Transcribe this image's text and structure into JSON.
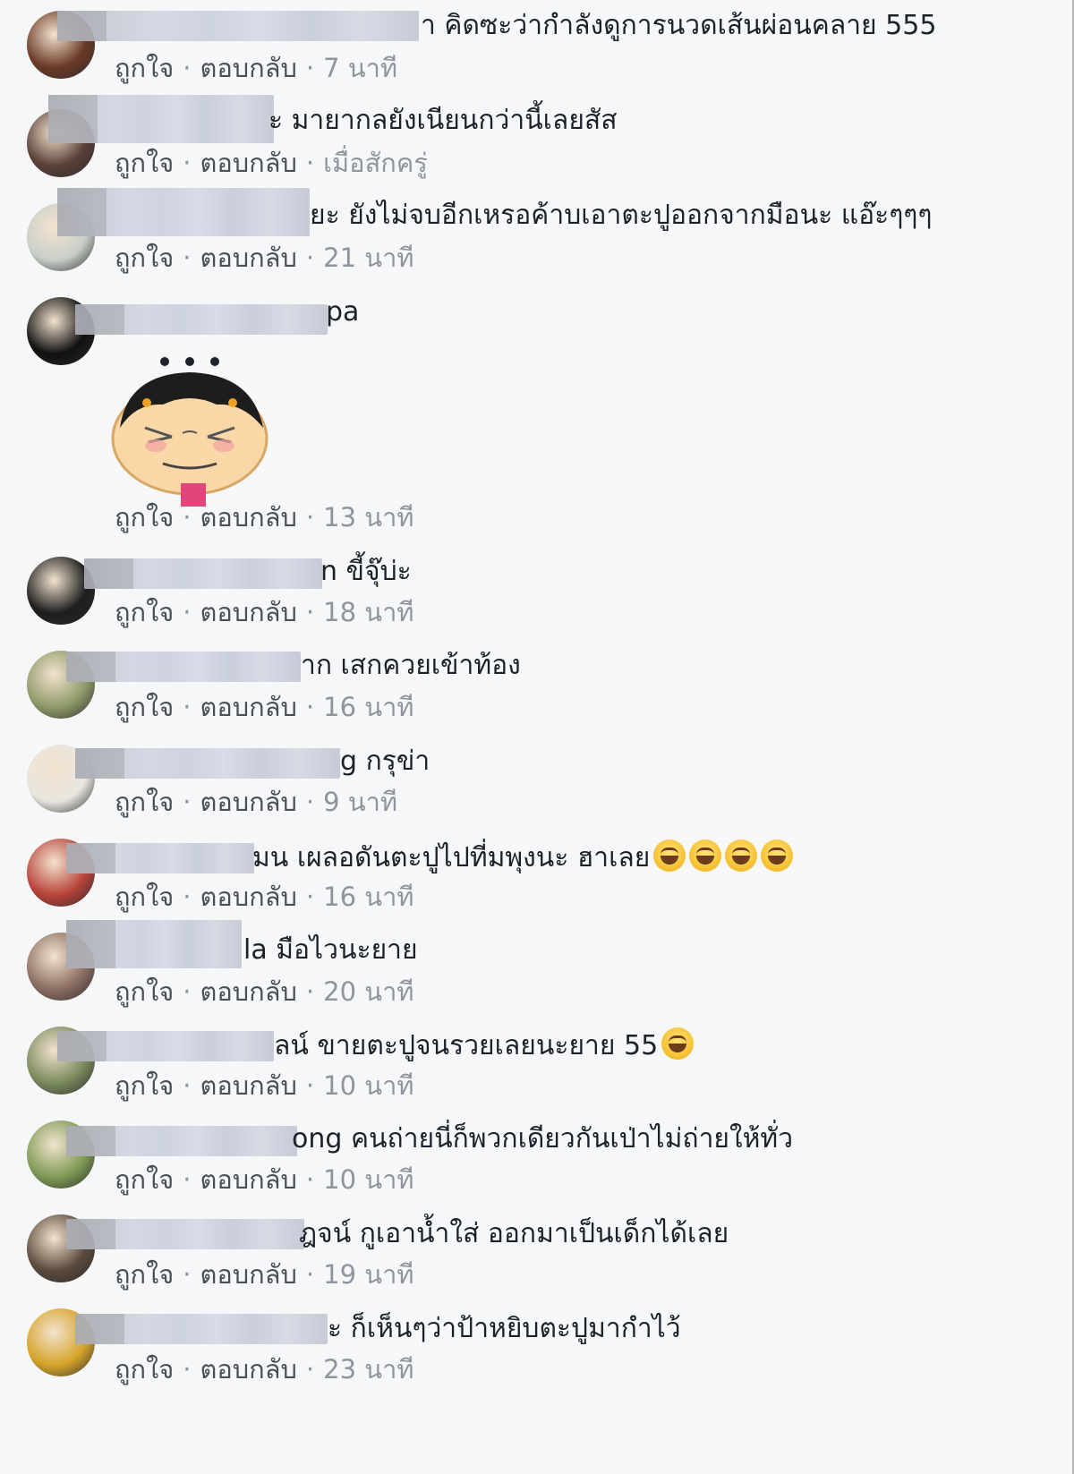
{
  "comments": [
    {
      "text": "า คิดซะว่ากำลังดูการนวดเส้นผ่อนคลาย 555",
      "like": "ถูกใจ",
      "reply": "ตอบกลับ",
      "time": "7 นาที"
    },
    {
      "text": "ะ มายากลยังเนียนกว่านี้เลยสัส",
      "like": "ถูกใจ",
      "reply": "ตอบกลับ",
      "time": "เมื่อสักครู่"
    },
    {
      "text": "ยะ ยังไม่จบอีกเหรอค้าบเอาตะปูออกจากมือนะ แอ๊ะๆๆๆ",
      "like": "ถูกใจ",
      "reply": "ตอบกลับ",
      "time": "21 นาที"
    },
    {
      "text": "pa",
      "like": "ถูกใจ",
      "reply": "ตอบกลับ",
      "time": "13 นาที",
      "sticker": "angry-girl-sticker"
    },
    {
      "text": "n ขี้จุ๊บ่ะ",
      "like": "ถูกใจ",
      "reply": "ตอบกลับ",
      "time": "18 นาที"
    },
    {
      "text": "าก เสกควยเข้าท้อง",
      "like": "ถูกใจ",
      "reply": "ตอบกลับ",
      "time": "16 นาที"
    },
    {
      "text": "g กรุข่า",
      "like": "ถูกใจ",
      "reply": "ตอบกลับ",
      "time": "9 นาที"
    },
    {
      "text": "มน เผลอดันตะปูไปที่มพุงนะ ฮาเลย",
      "like": "ถูกใจ",
      "reply": "ตอบกลับ",
      "time": "16 นาที",
      "emoji_count": 4
    },
    {
      "text": "la มือไวนะยาย",
      "like": "ถูกใจ",
      "reply": "ตอบกลับ",
      "time": "20 นาที"
    },
    {
      "text": "ลน์ ขายตะปูจนรวยเลยนะยาย 55",
      "like": "ถูกใจ",
      "reply": "ตอบกลับ",
      "time": "10 นาที",
      "emoji_count": 1
    },
    {
      "text": "ong คนถ่ายนี่ก็พวกเดียวกันเป่าไม่ถ่ายให้ทั่ว",
      "like": "ถูกใจ",
      "reply": "ตอบกลับ",
      "time": "10 นาที"
    },
    {
      "text": "ฎจน์ กูเอาน้ำใส่ ออกมาเป็นเด็กได้เลย",
      "like": "ถูกใจ",
      "reply": "ตอบกลับ",
      "time": "19 นาที"
    },
    {
      "text": "ะ ก็เห็นๆว่าป้าหยิบตะปูมากำไว้",
      "like": "ถูกใจ",
      "reply": "ตอบกลับ",
      "time": "23 นาที"
    }
  ],
  "avatar_colors": [
    "#6b3a26",
    "#5a4038",
    "#c9cfc9",
    "#111111",
    "#1e1e1e",
    "#8f9a6a",
    "#e9e6e0",
    "#b8433a",
    "#8c6e62",
    "#7b8a5e",
    "#7f9a55",
    "#5b4a3c",
    "#d6a42a"
  ],
  "emoji_icon": "grinning-squinting-face-icon",
  "colors": {
    "background": "#f6f7f9",
    "text": "#1d2129",
    "meta": "#90949c",
    "action": "#4b4f56"
  }
}
